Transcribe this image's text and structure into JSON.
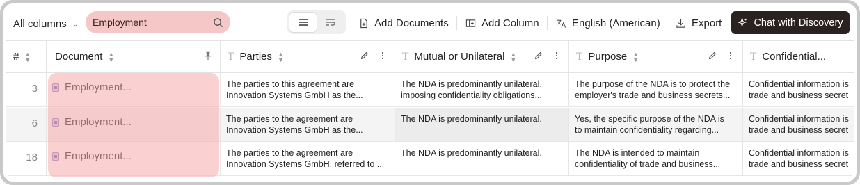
{
  "toolbar": {
    "column_selector": "All columns",
    "search_value": "Employment",
    "add_documents": "Add Documents",
    "add_column": "Add Column",
    "language": "English (American)",
    "export": "Export",
    "chat": "Chat with Discovery"
  },
  "table": {
    "headers": {
      "num": "#",
      "document": "Document",
      "parties": "Parties",
      "mutual": "Mutual or Unilateral",
      "purpose": "Purpose",
      "confidential": "Confidential..."
    },
    "rows": [
      {
        "num": "3",
        "document": "Employment...",
        "parties": [
          "The parties to this agreement are",
          "Innovation Systems GmbH as the..."
        ],
        "mutual": [
          "The NDA is predominantly unilateral,",
          "imposing confidentiality obligations..."
        ],
        "purpose": [
          "The purpose of the NDA is to protect the",
          "employer's trade and business secrets..."
        ],
        "confidential": [
          "Confidential information is",
          "trade and business secret"
        ]
      },
      {
        "num": "6",
        "document": "Employment...",
        "parties": [
          "The parties to the agreement are",
          "Innovation Systems GmbH as the..."
        ],
        "mutual": [
          "The NDA is predominantly unilateral.",
          ""
        ],
        "purpose": [
          "Yes, the specific purpose of the NDA is",
          "to maintain confidentiality regarding..."
        ],
        "confidential": [
          "Confidential information is",
          "trade and business secret"
        ]
      },
      {
        "num": "18",
        "document": "Employment...",
        "parties": [
          "The parties to the agreement are",
          "Innovation Systems GmbH, referred to ..."
        ],
        "mutual": [
          "The NDA is predominantly unilateral.",
          ""
        ],
        "purpose": [
          "The NDA is intended to maintain",
          "confidentiality of trade and business..."
        ],
        "confidential": [
          "Confidential information is",
          "trade and business secret"
        ]
      }
    ]
  },
  "colors": {
    "search_bg": "#f6c7c7",
    "highlight": "#f6aaaa",
    "chat_bg": "#2a2220",
    "doc_icon": "#8a7dc0"
  }
}
